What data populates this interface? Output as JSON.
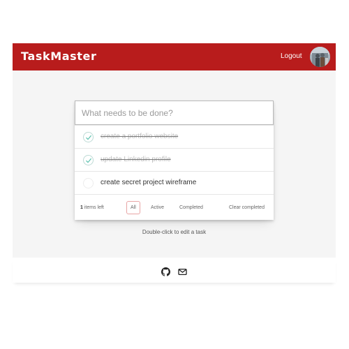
{
  "navbar": {
    "brand": "TaskMaster",
    "logout_label": "Logout",
    "avatar_icon": "user-avatar"
  },
  "todo": {
    "new_placeholder": "What needs to be done?",
    "items": [
      {
        "label": "create a portfolio website",
        "completed": true
      },
      {
        "label": "update Linkedin profile",
        "completed": true
      },
      {
        "label": "create secret project wireframe",
        "completed": false
      }
    ],
    "footer": {
      "count_number": "1",
      "count_suffix": " items left",
      "filters": [
        "All",
        "Active",
        "Completed"
      ],
      "selected_filter": "All",
      "clear_label": "Clear completed"
    }
  },
  "hint": "Double-click to edit a task",
  "site_footer": {
    "icons": [
      "github-icon",
      "mail-icon"
    ]
  },
  "colors": {
    "brand": "#b81c1c",
    "background": "#f5f5f5",
    "check": "#5dc2af",
    "filter_selected_border": "#e8a5a5"
  }
}
